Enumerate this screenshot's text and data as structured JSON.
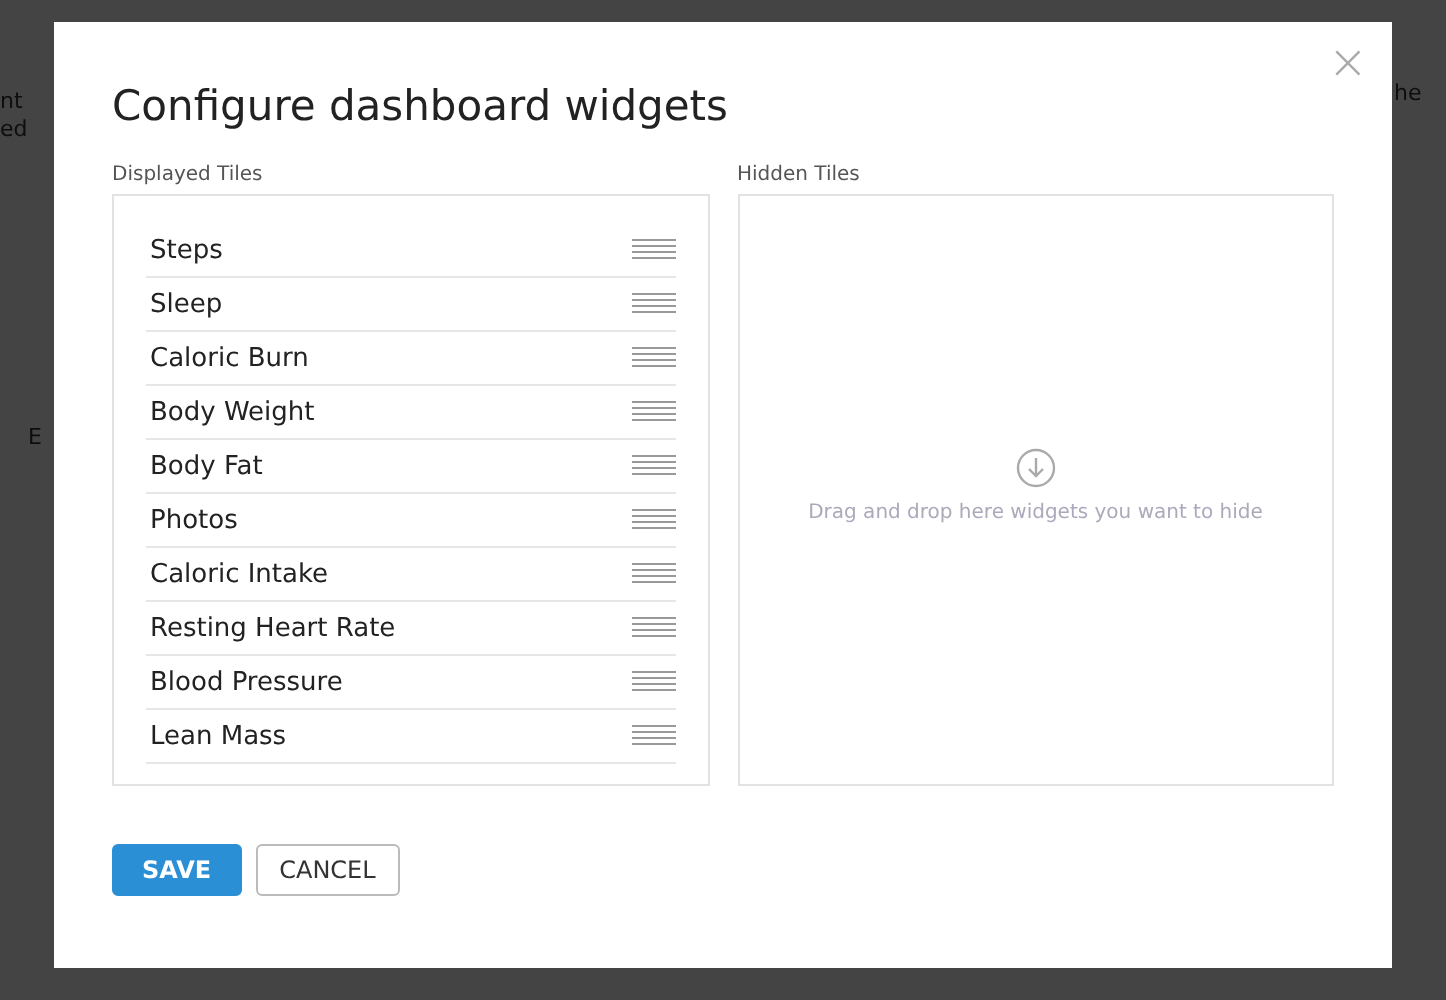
{
  "background": {
    "fragments": [
      "nt",
      "ed",
      "he",
      "E"
    ]
  },
  "dialog": {
    "title": "Configure dashboard widgets",
    "close": "×",
    "displayed": {
      "label": "Displayed Tiles",
      "tiles": [
        "Steps",
        "Sleep",
        "Caloric Burn",
        "Body Weight",
        "Body Fat",
        "Photos",
        "Caloric Intake",
        "Resting Heart Rate",
        "Blood Pressure",
        "Lean Mass"
      ]
    },
    "hidden": {
      "label": "Hidden Tiles",
      "hint": "Drag and drop here widgets you want to hide"
    },
    "buttons": [
      {
        "kind": "primary",
        "label": "SAVE"
      },
      {
        "kind": "secondary",
        "label": "CANCEL"
      }
    ]
  }
}
